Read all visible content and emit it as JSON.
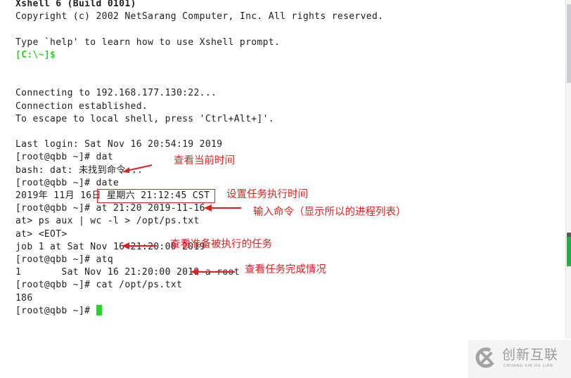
{
  "app": {
    "name": "Xshell 6 terminal"
  },
  "colors": {
    "text": "#1e1e1e",
    "prompt_local": "#27d327",
    "cursor": "#27d327",
    "annotation": "#e02020",
    "background": "#ffffff"
  },
  "terminal": {
    "lines": [
      {
        "text": "Xshell 6 (Build 0101)",
        "style": "bold"
      },
      {
        "text": "Copyright (c) 2002 NetSarang Computer, Inc. All rights reserved."
      },
      {
        "text": ""
      },
      {
        "text": "Type `help' to learn how to use Xshell prompt."
      },
      {
        "text": "[C:\\~]$",
        "style": "green"
      },
      {
        "text": ""
      },
      {
        "text": ""
      },
      {
        "text": "Connecting to 192.168.177.130:22..."
      },
      {
        "text": "Connection established."
      },
      {
        "text": "To escape to local shell, press 'Ctrl+Alt+]'."
      },
      {
        "text": ""
      },
      {
        "text": "Last login: Sat Nov 16 20:54:19 2019"
      },
      {
        "text": "[root@qbb ~]# dat"
      },
      {
        "text": "bash: dat: 未找到命令..."
      },
      {
        "text": "[root@qbb ~]# date"
      },
      {
        "text": "2019年 11月 16日 星期六 21:12:45 CST"
      },
      {
        "text": "[root@qbb ~]# at 21:20 2019-11-16"
      },
      {
        "text": "at> ps aux | wc -l > /opt/ps.txt"
      },
      {
        "text": "at> <EOT>"
      },
      {
        "text": "job 1 at Sat Nov 16 21:20:00 2019"
      },
      {
        "text": "[root@qbb ~]# atq"
      },
      {
        "text": "1       Sat Nov 16 21:20:00 2019 a root"
      },
      {
        "text": "[root@qbb ~]# cat /opt/ps.txt"
      },
      {
        "text": "186"
      },
      {
        "text": "[root@qbb ~]# ",
        "cursor": true
      }
    ]
  },
  "annotations": [
    {
      "text": "查看当前时间",
      "target_line": 14
    },
    {
      "text": "设置任务执行时间",
      "target_line": 16,
      "boxed": "at 21:20 2019-11-16"
    },
    {
      "text": "输入命令（显示所以的进程列表）",
      "target_line": 17
    },
    {
      "text": "查看准备被执行的任务",
      "target_line": 20
    },
    {
      "text": "查看任务完成情况",
      "target_line": 22
    }
  ],
  "watermark": {
    "title": "创新互联",
    "subtitle": "CHUANG XIN HU LIAN"
  }
}
